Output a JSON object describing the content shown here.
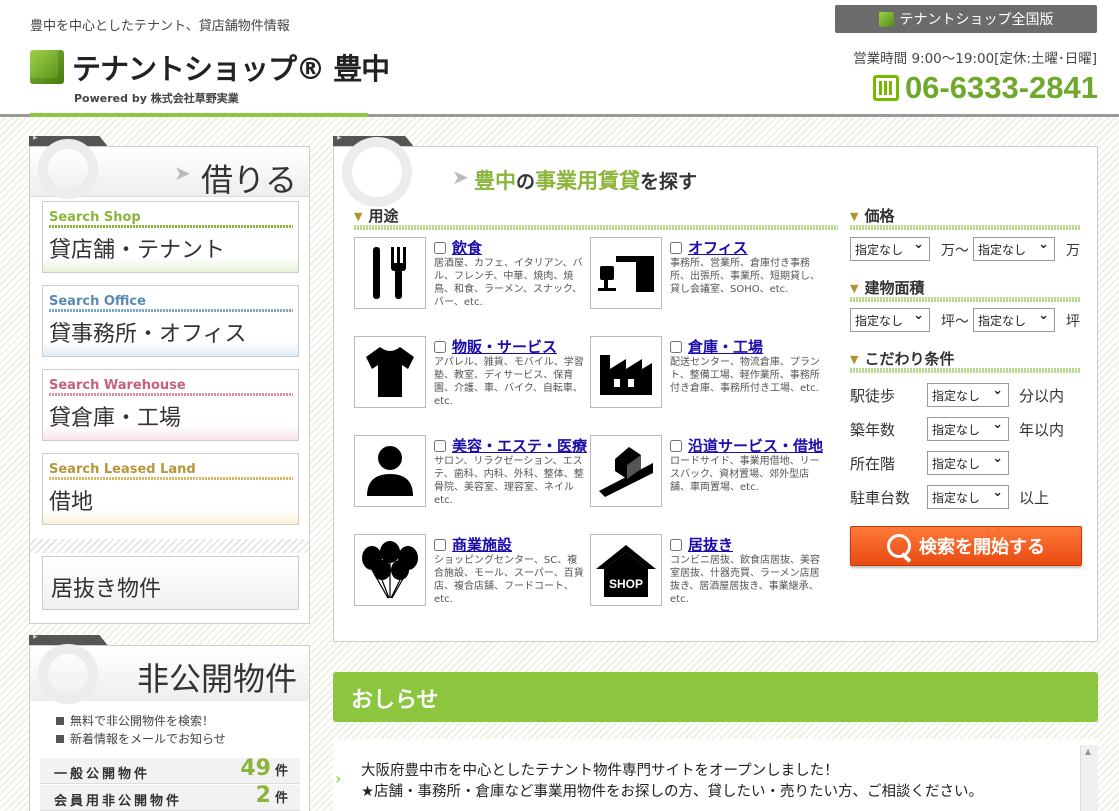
{
  "header": {
    "tagline": "豊中を中心としたテナント、貸店舗物件情報",
    "logo_name": "テナントショップ® 豊中",
    "powered": "Powered by 株式会社草野実業",
    "national_btn": "テナントショップ全国版",
    "hours": "営業時間 9:00〜19:00[定休:土曜･日曜]",
    "phone": "06-6333-2841"
  },
  "sidebar": {
    "rent_title": "借りる",
    "buttons": [
      {
        "en": "Search Shop",
        "jp": "貸店舗・テナント"
      },
      {
        "en": "Search Office",
        "jp": "貸事務所・オフィス"
      },
      {
        "en": "Search Warehouse",
        "jp": "貸倉庫・工場"
      },
      {
        "en": "Search Leased Land",
        "jp": "借地"
      }
    ],
    "inuki": "居抜き物件",
    "np_title": "非公開物件",
    "np_bullets": [
      "無料で非公開物件を検索！",
      "新着情報をメールでお知らせ"
    ],
    "stats": [
      {
        "label": "一般公開物件",
        "count": "49",
        "unit": "件"
      },
      {
        "label": "会員用非公開物件",
        "count": "2",
        "unit": "件"
      }
    ]
  },
  "search": {
    "title_a": "豊中",
    "title_b": "の",
    "title_c": "事業用賃貸",
    "title_d": "を探す",
    "usage_label": "用途",
    "usages": [
      {
        "title": "飲食",
        "desc": "居酒屋、カフェ、イタリアン、バル、フレンチ、中華、焼肉、焼鳥、和食、ラーメン、スナック、バー、etc."
      },
      {
        "title": "オフィス",
        "desc": "事務所、営業所、倉庫付き事務所、出張所、事業所、短期貸し、貸し会議室、SOHO、etc."
      },
      {
        "title": "物販・サービス",
        "desc": "アパレル、雑貨、モバイル、学習塾、教室、ディサービス、保育園、介護、車、バイク、自転車、etc."
      },
      {
        "title": "倉庫・工場",
        "desc": "配送センター、物流倉庫、プラント、整備工場、軽作業所、事務所付き倉庫、事務所付き工場、etc."
      },
      {
        "title": "美容・エステ・医療",
        "desc": "サロン、リラクゼーション、エステ、歯科、内科、外科、整体、整骨院、美容室、理容室、ネイル etc."
      },
      {
        "title": "沿道サービス・借地",
        "desc": "ロードサイド、事業用借地、リースバック、資材置場、郊外型店舗、車両置場、etc."
      },
      {
        "title": "商業施設",
        "desc": "ショッピングセンター、SC、複合施設、モール、スーパー、百貨店、複合店舗、フードコート、etc."
      },
      {
        "title": "居抜き",
        "desc": "コンビニ居抜、飲食店居抜、美容室居抜、什器売買、ラーメン店居抜き、居酒屋居抜き、事業継承、etc."
      }
    ],
    "price_label": "価格",
    "area_label": "建物面積",
    "cond_label": "こだわり条件",
    "select_default": "指定なし",
    "price_unit_from": "万〜",
    "price_unit_to": "万",
    "area_unit_from": "坪〜",
    "area_unit_to": "坪",
    "conds": [
      {
        "label": "駅徒歩",
        "unit": "分以内"
      },
      {
        "label": "築年数",
        "unit": "年以内"
      },
      {
        "label": "所在階",
        "unit": ""
      },
      {
        "label": "駐車台数",
        "unit": "以上"
      }
    ],
    "search_btn": "検索を開始する"
  },
  "news": {
    "title": "おしらせ",
    "line1": "大阪府豊中市を中心としたテナント物件専門サイトをオープンしました！",
    "line2": "★店舗・事務所・倉庫など事業用物件をお探しの方、貸したい・売りたい方、ご相談ください。"
  }
}
